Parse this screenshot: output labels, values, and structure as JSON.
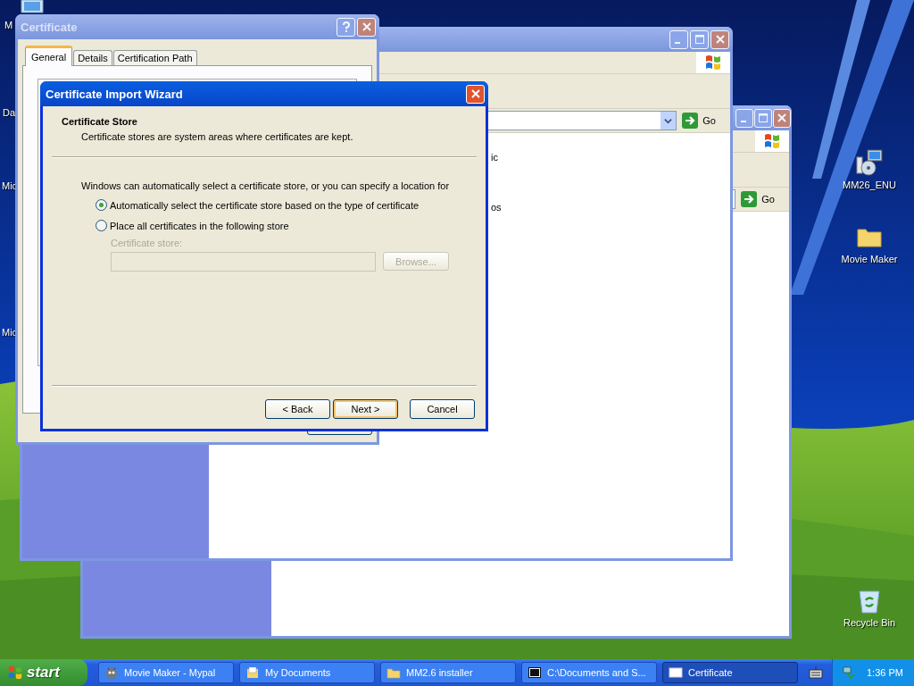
{
  "desktop_icons_left": [
    {
      "label": "M",
      "kind": "computer"
    },
    {
      "label": "Da",
      "kind": "none"
    },
    {
      "label": "Mic",
      "kind": "none"
    },
    {
      "label": "Mic",
      "kind": "none"
    }
  ],
  "desktop_icons_right": [
    {
      "label": "MM26_ENU",
      "kind": "installer"
    },
    {
      "label": "Movie Maker",
      "kind": "folder"
    },
    {
      "label": "Recycle Bin",
      "kind": "recycle"
    }
  ],
  "explorer_windows": [
    {
      "active": false,
      "go": "Go"
    },
    {
      "active": false,
      "go": "Go",
      "items": [
        "ic",
        "os"
      ]
    }
  ],
  "certificate": {
    "title": "Certificate",
    "active": false,
    "tabs": [
      {
        "label": "General",
        "selected": true
      },
      {
        "label": "Details",
        "selected": false
      },
      {
        "label": "Certification Path",
        "selected": false
      }
    ]
  },
  "wizard": {
    "title": "Certificate Import Wizard",
    "active": true,
    "heading": "Certificate Store",
    "subheading": "Certificate stores are system areas where certificates are kept.",
    "intro": "Windows can automatically select a certificate store, or you can specify a location for",
    "options": [
      {
        "label": "Automatically select the certificate store based on the type of certificate",
        "selected": true
      },
      {
        "label": "Place all certificates in the following store",
        "selected": false
      }
    ],
    "store_label": "Certificate store:",
    "store_disabled": true,
    "browse": "Browse...",
    "buttons": [
      {
        "label": "< Back",
        "focused": false
      },
      {
        "label": "Next >",
        "focused": true
      },
      {
        "label": "Cancel",
        "focused": false
      }
    ]
  },
  "taskbar": {
    "start": "start",
    "tasks": [
      {
        "label": "Movie Maker - Mypal",
        "kind": "browser",
        "selected": false
      },
      {
        "label": "My Documents",
        "kind": "documents",
        "selected": false
      },
      {
        "label": "MM2.6 installer",
        "kind": "folder",
        "selected": false
      },
      {
        "label": "C:\\Documents and S...",
        "kind": "archive",
        "selected": false
      },
      {
        "label": "Certificate",
        "kind": "window",
        "selected": true
      }
    ],
    "clock": "1:36 PM"
  }
}
